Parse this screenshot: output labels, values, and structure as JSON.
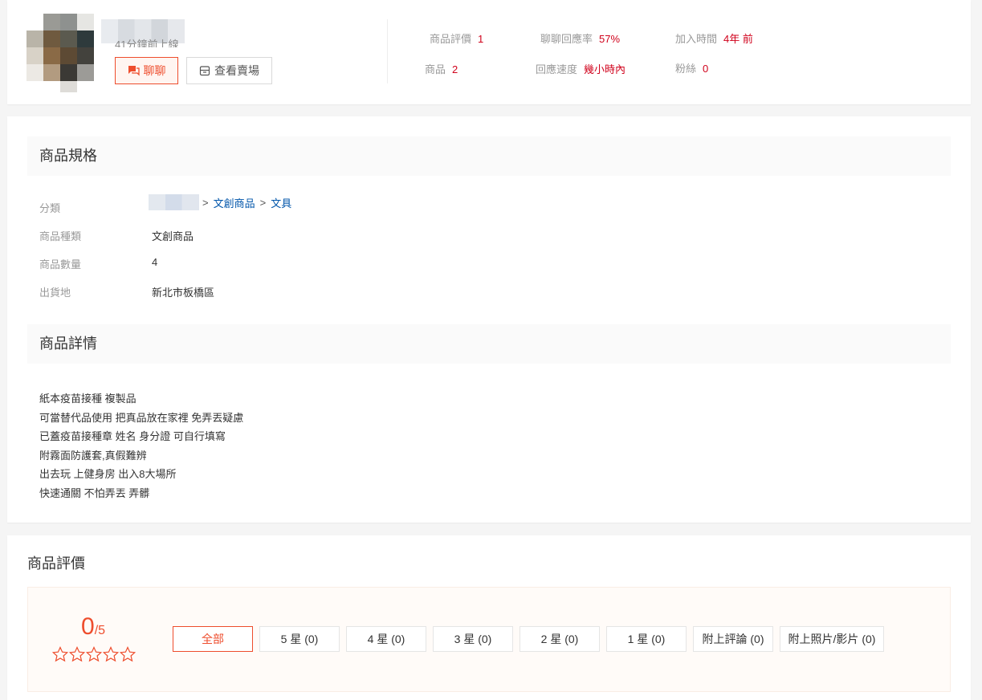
{
  "seller": {
    "online_status": "41分鐘前上線",
    "chat_label": "聊聊",
    "view_shop_label": "查看賣場",
    "stats": {
      "rating_label": "商品評價",
      "rating_value": "1",
      "products_label": "商品",
      "products_value": "2",
      "chat_rate_label": "聊聊回應率",
      "chat_rate_value": "57%",
      "response_speed_label": "回應速度",
      "response_speed_value": "幾小時內",
      "joined_label": "加入時間",
      "joined_value": "4年 前",
      "followers_label": "粉絲",
      "followers_value": "0"
    }
  },
  "spec": {
    "title": "商品規格",
    "category_label": "分類",
    "category_path": [
      "文創商品",
      "文具"
    ],
    "type_label": "商品種類",
    "type_value": "文創商品",
    "qty_label": "商品數量",
    "qty_value": "4",
    "ship_label": "出貨地",
    "ship_value": "新北市板橋區"
  },
  "details": {
    "title": "商品詳情",
    "lines": [
      "紙本疫苗接種 複製品",
      "可當替代品使用 把真品放在家裡 免弄丟疑慮",
      "已蓋疫苗接種章  姓名 身分證 可自行填寫",
      "附霧面防護套,真假難辨",
      "出去玩 上健身房 出入8大場所",
      "快速通關 不怕弄丟 弄髒"
    ]
  },
  "ratings": {
    "title": "商品評價",
    "score": "0",
    "out_of": "/5",
    "stars": 5,
    "filters": [
      {
        "label": "全部",
        "active": true
      },
      {
        "label": "5 星 (0)",
        "active": false
      },
      {
        "label": "4 星 (0)",
        "active": false
      },
      {
        "label": "3 星 (0)",
        "active": false
      },
      {
        "label": "2 星 (0)",
        "active": false
      },
      {
        "label": "1 星 (0)",
        "active": false
      },
      {
        "label": "附上評論 (0)",
        "active": false
      },
      {
        "label": "附上照片/影片 (0)",
        "active": false
      }
    ]
  },
  "colors": {
    "accent": "#ee4d2d",
    "stat_value": "#d0011b",
    "link": "#0055aa"
  }
}
